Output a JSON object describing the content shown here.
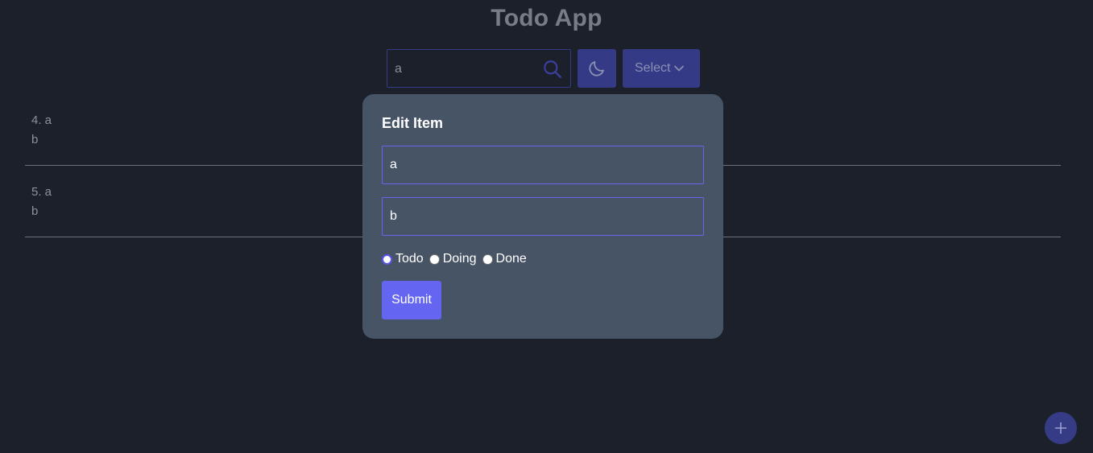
{
  "app": {
    "title": "Todo App"
  },
  "toolbar": {
    "search": {
      "value": "a",
      "icon": "search-icon"
    },
    "theme_toggle": {
      "icon": "moon-icon"
    },
    "select": {
      "label": "Select",
      "icon": "chevron-down-icon"
    }
  },
  "list": {
    "items": [
      {
        "heading": "4. a",
        "description": "b"
      },
      {
        "heading": "5. a",
        "description": "b"
      }
    ]
  },
  "modal": {
    "title": "Edit Item",
    "title_value": "a",
    "description_value": "b",
    "status_options": [
      {
        "label": "Todo",
        "checked": true
      },
      {
        "label": "Doing",
        "checked": false
      },
      {
        "label": "Done",
        "checked": false
      }
    ],
    "submit_label": "Submit"
  },
  "fab": {
    "icon": "plus-icon"
  },
  "colors": {
    "background": "#1b202a",
    "accent": "#6466f1",
    "accent_dim": "#353a86",
    "modal_bg": "#475466"
  }
}
